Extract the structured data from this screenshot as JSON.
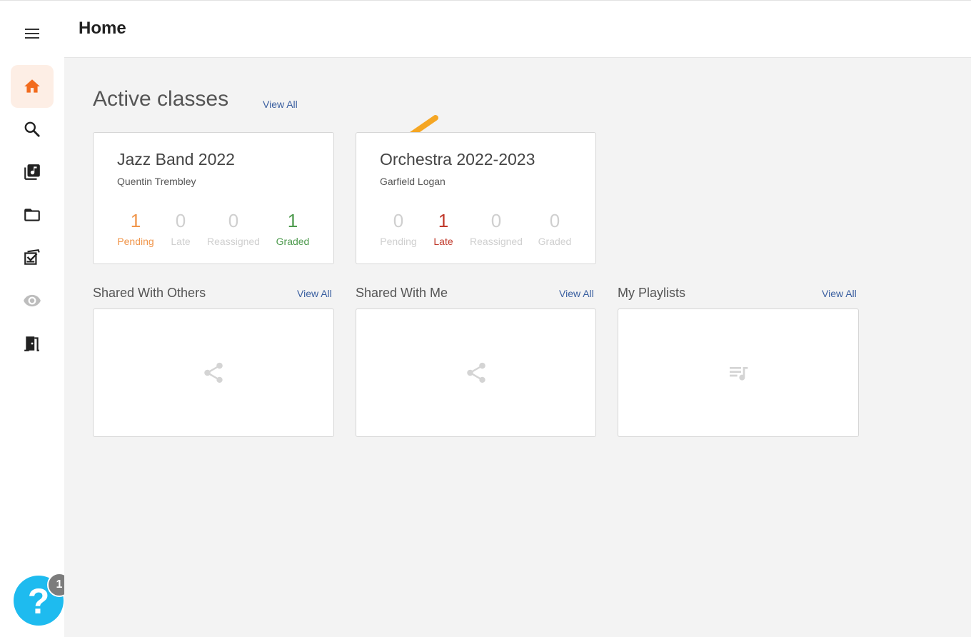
{
  "header": {
    "title": "Home"
  },
  "sidebar": {
    "items": [
      {
        "name": "home",
        "icon": "home-icon",
        "active": true
      },
      {
        "name": "search",
        "icon": "search-icon"
      },
      {
        "name": "library",
        "icon": "music-library-icon"
      },
      {
        "name": "folders",
        "icon": "folder-icon"
      },
      {
        "name": "assignments",
        "icon": "assignment-icon"
      },
      {
        "name": "preview",
        "icon": "eye-icon"
      },
      {
        "name": "exit",
        "icon": "door-exit-icon"
      }
    ],
    "help": {
      "label": "?",
      "badge": "1"
    }
  },
  "active_classes": {
    "title": "Active classes",
    "view_all": "View All",
    "classes": [
      {
        "name": "Jazz Band 2022",
        "teacher": "Quentin Trembley",
        "stats": [
          {
            "value": "1",
            "label": "Pending"
          },
          {
            "value": "0",
            "label": "Late"
          },
          {
            "value": "0",
            "label": "Reassigned"
          },
          {
            "value": "1",
            "label": "Graded"
          }
        ]
      },
      {
        "name": "Orchestra 2022-2023",
        "teacher": "Garfield Logan",
        "stats": [
          {
            "value": "0",
            "label": "Pending"
          },
          {
            "value": "1",
            "label": "Late"
          },
          {
            "value": "0",
            "label": "Reassigned"
          },
          {
            "value": "0",
            "label": "Graded"
          }
        ]
      }
    ]
  },
  "sections": [
    {
      "title": "Shared With Others",
      "view_all": "View All",
      "icon": "share-icon"
    },
    {
      "title": "Shared With Me",
      "view_all": "View All",
      "icon": "share-icon"
    },
    {
      "title": "My Playlists",
      "view_all": "View All",
      "icon": "playlist-icon"
    }
  ],
  "colors": {
    "accent": "#f26b1d",
    "link": "#3a5fa0",
    "pending": "#f0954a",
    "graded": "#4d9a4d",
    "late": "#c0392b",
    "help": "#1ebbef",
    "arrow": "#f5a623"
  }
}
